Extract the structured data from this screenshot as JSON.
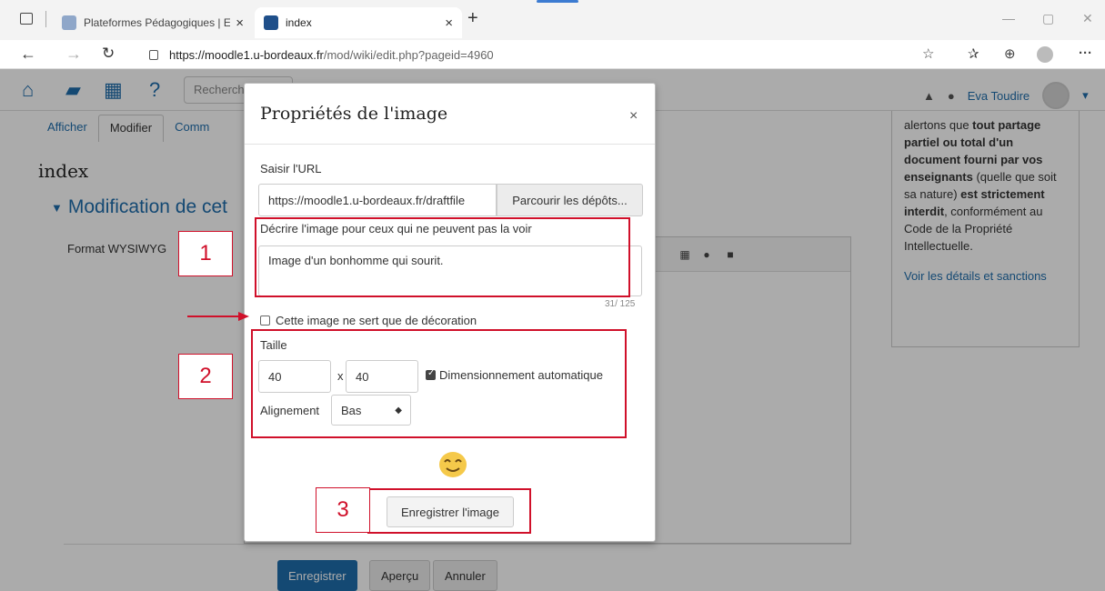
{
  "browser": {
    "tabs": [
      {
        "title": "Plateformes Pédagogiques | ENT",
        "active": false
      },
      {
        "title": "index",
        "active": true
      }
    ],
    "new_tab_glyph": "+",
    "close_glyph": "×",
    "url_host": "https://moodle1.u-bordeaux.fr",
    "url_path": "/mod/wiki/edit.php?pageid=4960",
    "controls": {
      "minimize": "—",
      "maximize": "▢",
      "close": "✕"
    }
  },
  "navbar": {
    "search_placeholder": "Recherch",
    "user_name": "Eva Toudire"
  },
  "page": {
    "tabs": [
      "Afficher",
      "Modifier",
      "Comm"
    ],
    "heading": "index",
    "section_heading": "Modification de cet",
    "format_label": "Format WYSIWYG",
    "buttons": {
      "save": "Enregistrer",
      "preview": "Aperçu",
      "cancel": "Annuler"
    },
    "side_block": {
      "t1": "alertons que ",
      "b1": "tout partage partiel ou total d'un document fourni par vos enseignants",
      "t2": " (quelle que soit sa nature) ",
      "b2": "est strictement interdit",
      "t3": ", conformément au Code de la Propriété Intellectuelle.",
      "link": "Voir les détails et sanctions"
    }
  },
  "dialog": {
    "title": "Propriétés de l'image",
    "close_glyph": "×",
    "url_label": "Saisir l'URL",
    "url_value": "https://moodle1.u-bordeaux.fr/draftfile",
    "browse_label": "Parcourir les dépôts...",
    "alt_label": "Décrire l'image pour ceux qui ne peuvent pas la voir",
    "alt_value": "Image d'un bonhomme qui sourit.",
    "alt_counter": "31/ 125",
    "decorative_label": "Cette image ne sert que de décoration",
    "decorative_checked": false,
    "size_label": "Taille",
    "width": "40",
    "height": "40",
    "size_sep": "x",
    "auto_size_label": "Dimensionnement automatique",
    "auto_size_checked": true,
    "align_label": "Alignement",
    "align_value": "Bas",
    "save_label": "Enregistrer l'image"
  },
  "annotations": {
    "numbers": [
      "1",
      "2",
      "3"
    ],
    "color": "#d0102a"
  },
  "colors": {
    "moodle_blue": "#1f6dac",
    "annotation_red": "#d0102a"
  }
}
